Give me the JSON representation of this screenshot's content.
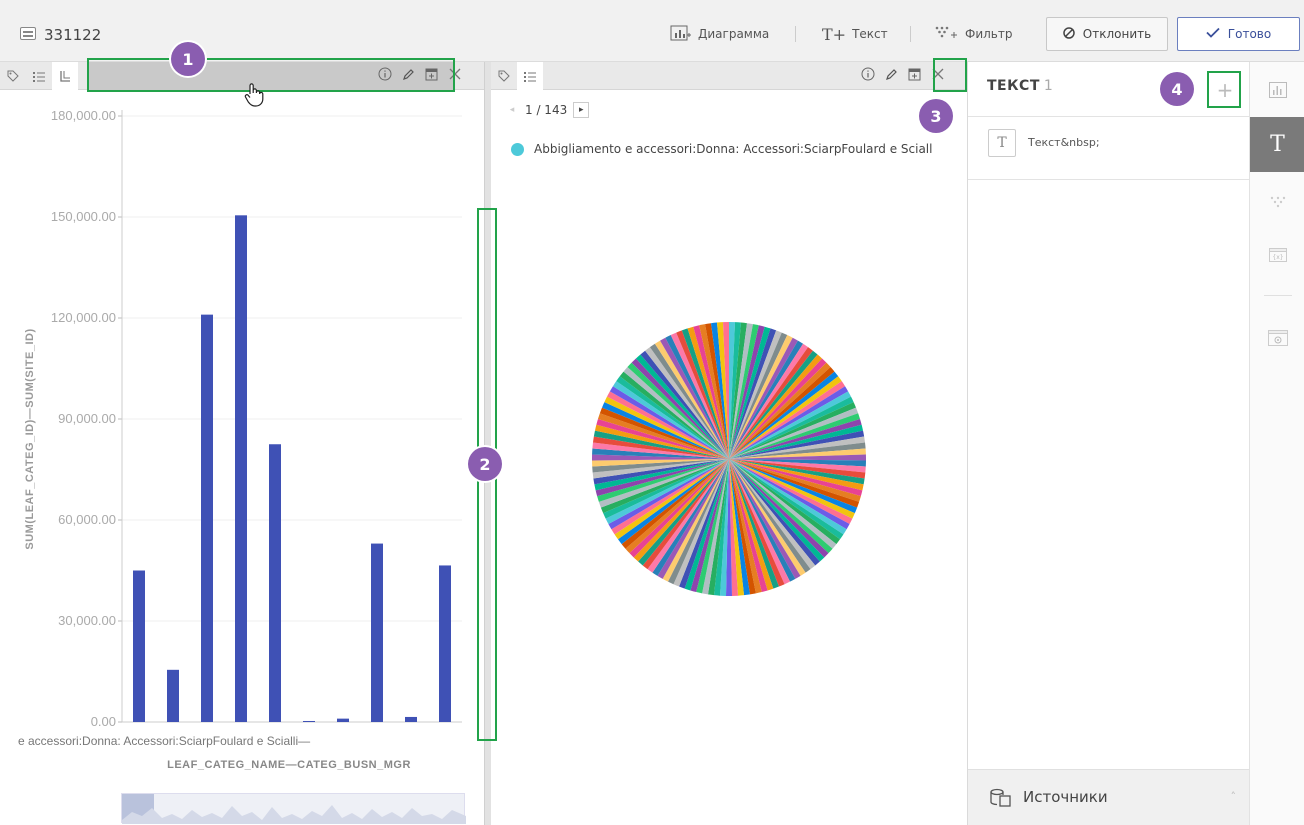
{
  "topbar": {
    "doc_title": "331122",
    "btn_chart": "Диаграмма",
    "btn_text": "Текст",
    "btn_filter": "Фильтр",
    "btn_reject": "Отклонить",
    "btn_done": "Готово"
  },
  "left_pane": {
    "ylabel": "SUM(LEAF_CATEG_ID)—SUM(SITE_ID)",
    "xlabel": "LEAF_CATEG_NAME—CATEG_BUSN_MGR",
    "x_tick": "e accessori:Donna: Accessori:SciarpFoulard e Scialli—"
  },
  "mid_pane": {
    "pager": "1 / 143",
    "legend_item": "Abbigliamento e accessori:Donna: Accessori:SciarpFoulard e Sciall"
  },
  "right_panel": {
    "title": "ТЕКСТ",
    "count": "1",
    "item_label": "Текст&nbsp;",
    "item_icon": "T",
    "sources": "Источники"
  },
  "badges": [
    "1",
    "2",
    "3",
    "4"
  ],
  "colors": {
    "bar": "#3f51b5",
    "highlight": "#22a34a",
    "badge": "#8a5db0"
  },
  "chart_data": [
    {
      "type": "bar",
      "ylabel": "SUM(LEAF_CATEG_ID)—SUM(SITE_ID)",
      "xlabel": "LEAF_CATEG_NAME—CATEG_BUSN_MGR",
      "yticks": [
        "0.00",
        "30,000.00",
        "60,000.00",
        "90,000.00",
        "120,000.00",
        "150,000.00",
        "180,000.00"
      ],
      "ylim": [
        0,
        180000
      ],
      "values": [
        45000,
        15500,
        121000,
        150500,
        82500,
        300,
        1000,
        53000,
        1500,
        46500
      ],
      "grid": true
    },
    {
      "type": "pie",
      "slices": 143,
      "colors": [
        "#4dc9d9",
        "#3f51b5",
        "#e74c3c",
        "#f1c40f",
        "#2ecc71",
        "#9b59b6",
        "#e67e22",
        "#1abc9c",
        "#c0c0c0",
        "#16a085",
        "#ff6f91",
        "#8e44ad",
        "#2980b9",
        "#d35400",
        "#27ae60",
        "#7f8c8d",
        "#f39c12",
        "#6c5ce7",
        "#00b894",
        "#fd79a8",
        "#0984e3",
        "#b2bec3",
        "#fdcb6e",
        "#e84393"
      ]
    }
  ]
}
